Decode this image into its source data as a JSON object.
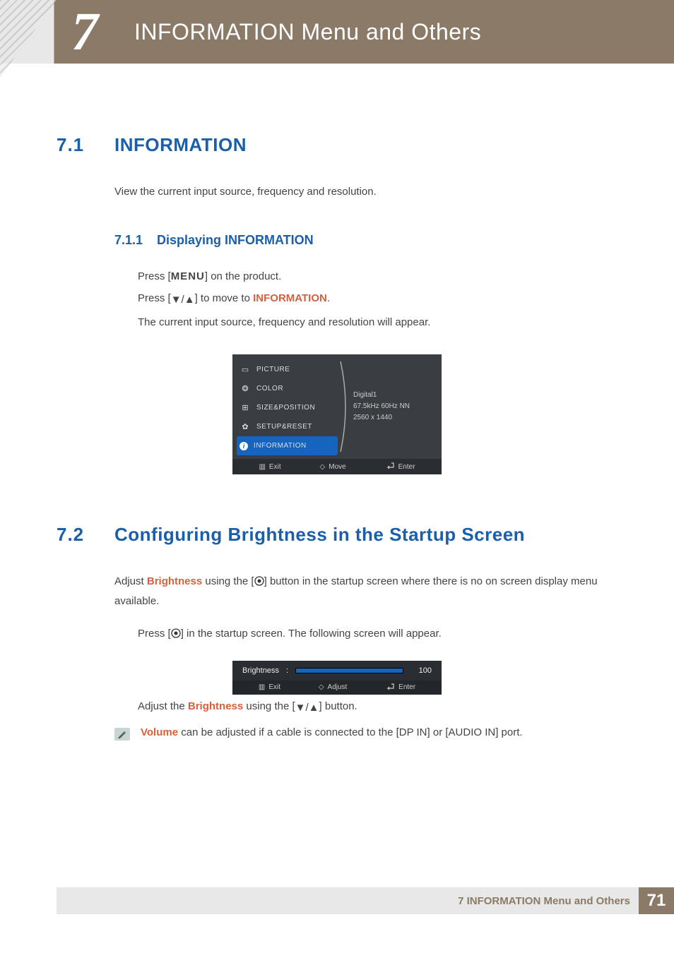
{
  "chapter": {
    "number": "7",
    "title": "INFORMATION Menu and Others"
  },
  "sec71": {
    "num": "7.1",
    "title": "INFORMATION",
    "intro": "View the current input source, frequency and resolution."
  },
  "sub711": {
    "num": "7.1.1",
    "title": "Displaying INFORMATION",
    "step1_a": "Press [",
    "menu_label": "MENU",
    "step1_b": "] on the product.",
    "step2_a": "Press [",
    "step2_b": "] to move to ",
    "step2_hi": "INFORMATION",
    "step2_c": ".",
    "step3": "The current input source, frequency and resolution will appear."
  },
  "osd": {
    "items": [
      "PICTURE",
      "COLOR",
      "SIZE&POSITION",
      "SETUP&RESET",
      "INFORMATION"
    ],
    "info": {
      "source": "Digital1",
      "freq": "67.5kHz 60Hz NN",
      "res": "2560 x 1440"
    },
    "footer": {
      "exit": "Exit",
      "move": "Move",
      "enter": "Enter"
    }
  },
  "sec72": {
    "num": "7.2",
    "title": "Configuring Brightness in the Startup Screen",
    "p1_a": "Adjust ",
    "p1_hi": "Brightness",
    "p1_b": " using the [",
    "p1_c": "] button in the startup screen where there is no on screen display menu available.",
    "step_a": "Press [",
    "step_b": "] in the startup screen. The following screen will appear.",
    "adjust_a": "Adjust the ",
    "adjust_hi": "Brightness",
    "adjust_b": " using the [",
    "adjust_c": "] button.",
    "note_hi": "Volume",
    "note_b": " can be adjusted if a cable is connected to the [DP IN] or [AUDIO IN] port."
  },
  "bright_osd": {
    "label": "Brightness",
    "value": "100",
    "footer": {
      "exit": "Exit",
      "adjust": "Adjust",
      "enter": "Enter"
    }
  },
  "footer": {
    "text": "7 INFORMATION Menu and Others",
    "page": "71"
  }
}
